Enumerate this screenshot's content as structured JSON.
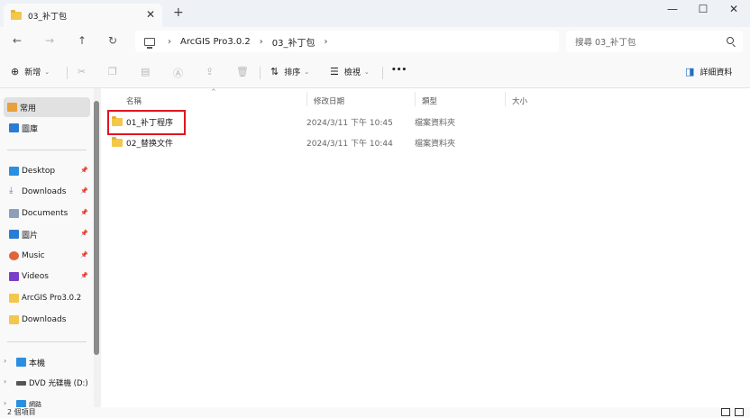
{
  "tab": {
    "title": "03_补丁包",
    "close": "✕",
    "new": "+"
  },
  "window": {
    "minimize": "—",
    "maximize": "☐",
    "close": "✕"
  },
  "nav": {
    "back": "←",
    "forward": "→",
    "up": "↑",
    "refresh": "↻"
  },
  "breadcrumb": {
    "sep": "›",
    "items": [
      "ArcGIS Pro3.0.2",
      "03_补丁包"
    ]
  },
  "search": {
    "placeholder": "搜尋 03_补丁包"
  },
  "toolbar": {
    "new_label": "新增",
    "sort_label": "排序",
    "view_label": "檢視",
    "more_label": "•••",
    "details_label": "詳細資料"
  },
  "sidebar": {
    "items": [
      {
        "label": "常用",
        "icon": "home-icon",
        "color": "#e8a13a"
      },
      {
        "label": "圖庫",
        "icon": "gallery-icon",
        "color": "#2b7cd3"
      },
      {
        "label": "Desktop",
        "icon": "desktop-icon",
        "color": "#2b8fe0"
      },
      {
        "label": "Downloads",
        "icon": "download-icon",
        "color": "#2b8fe0"
      },
      {
        "label": "Documents",
        "icon": "document-icon",
        "color": "#8aa0b8"
      },
      {
        "label": "圖片",
        "icon": "pictures-icon",
        "color": "#2b7cd3"
      },
      {
        "label": "Music",
        "icon": "music-icon",
        "color": "#e0643b"
      },
      {
        "label": "Videos",
        "icon": "video-icon",
        "color": "#7a3fc9"
      },
      {
        "label": "ArcGIS Pro3.0.2",
        "icon": "folder-icon",
        "color": "#f3c74b"
      },
      {
        "label": "Downloads",
        "icon": "folder-icon",
        "color": "#f3c74b"
      },
      {
        "label": "本機",
        "icon": "pc-icon",
        "color": "#2b8fe0"
      },
      {
        "label": "DVD 光碟機 (D:)",
        "icon": "dvd-icon",
        "color": "#555555"
      },
      {
        "label": "網路",
        "icon": "network-icon",
        "color": "#2b8fe0"
      }
    ]
  },
  "columns": {
    "name": "名稱",
    "date": "修改日期",
    "type": "類型",
    "size": "大小"
  },
  "files": [
    {
      "name": "01_补丁程序",
      "date": "2024/3/11 下午 10:45",
      "type": "檔案資料夾"
    },
    {
      "name": "02_替换文件",
      "date": "2024/3/11 下午 10:44",
      "type": "檔案資料夾"
    }
  ],
  "status": {
    "count": "2 個項目"
  },
  "colors": {
    "highlight": "#e0161e",
    "folder": "#f3c74b"
  }
}
